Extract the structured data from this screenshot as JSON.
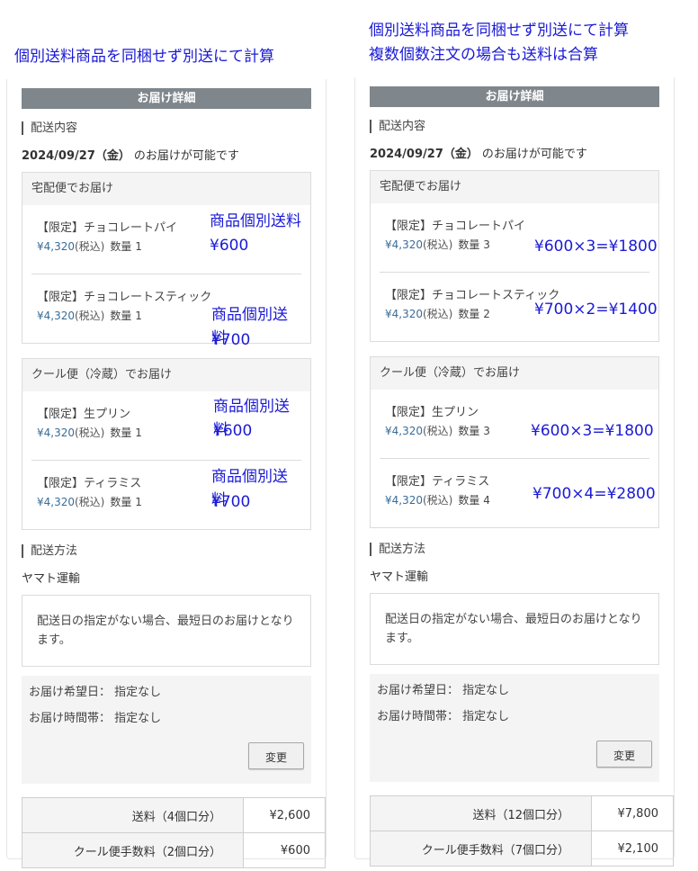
{
  "captions": {
    "left": "個別送料商品を同梱せず別送にて計算",
    "right_line1": "個別送料商品を同梱せず別送にて計算",
    "right_line2": "複数個数注文の場合も送料は合算"
  },
  "colors": {
    "header_bar": "#7f878d",
    "price_link": "#3a6d97",
    "annotation": "#1a1ad6"
  },
  "left": {
    "header": "お届け詳細",
    "section_contents": "配送内容",
    "delivery_date": "2024/09/27（金）",
    "delivery_date_suffix": "のお届けが可能です",
    "groups": [
      {
        "title": "宅配便でお届け",
        "items": [
          {
            "name": "【限定】チョコレートパイ",
            "price": "¥4,320",
            "tax": "(税込)",
            "qty": "数量 1",
            "anno1": "商品個別送料",
            "anno2": "¥600"
          },
          {
            "name": "【限定】チョコレートスティック",
            "price": "¥4,320",
            "tax": "(税込)",
            "qty": "数量 1",
            "anno1": "商品個別送料",
            "anno2": "¥700"
          }
        ]
      },
      {
        "title": "クール便（冷蔵）でお届け",
        "items": [
          {
            "name": "【限定】生プリン",
            "price": "¥4,320",
            "tax": "(税込)",
            "qty": "数量 1",
            "anno1": "商品個別送料",
            "anno2": "¥600"
          },
          {
            "name": "【限定】ティラミス",
            "price": "¥4,320",
            "tax": "(税込)",
            "qty": "数量 1",
            "anno1": "商品個別送料",
            "anno2": "¥700"
          }
        ]
      }
    ],
    "section_method": "配送方法",
    "carrier": "ヤマト運輸",
    "notice": "配送日の指定がない場合、最短日のお届けとなります。",
    "pref_date": "お届け希望日：  指定なし",
    "pref_time": "お届け時間帯：  指定なし",
    "change_label": "変更",
    "fees": [
      {
        "label": "送料（4個口分）",
        "value": "¥2,600"
      },
      {
        "label": "クール便手数料（2個口分）",
        "value": "¥600"
      }
    ]
  },
  "right": {
    "header": "お届け詳細",
    "section_contents": "配送内容",
    "delivery_date": "2024/09/27（金）",
    "delivery_date_suffix": "のお届けが可能です",
    "groups": [
      {
        "title": "宅配便でお届け",
        "items": [
          {
            "name": "【限定】チョコレートパイ",
            "price": "¥4,320",
            "tax": "(税込)",
            "qty": "数量 3",
            "anno": "¥600×3=¥1800"
          },
          {
            "name": "【限定】チョコレートスティック",
            "price": "¥4,320",
            "tax": "(税込)",
            "qty": "数量 2",
            "anno": "¥700×2=¥1400"
          }
        ]
      },
      {
        "title": "クール便（冷蔵）でお届け",
        "items": [
          {
            "name": "【限定】生プリン",
            "price": "¥4,320",
            "tax": "(税込)",
            "qty": "数量 3",
            "anno": "¥600×3=¥1800"
          },
          {
            "name": "【限定】ティラミス",
            "price": "¥4,320",
            "tax": "(税込)",
            "qty": "数量 4",
            "anno": "¥700×4=¥2800"
          }
        ]
      }
    ],
    "section_method": "配送方法",
    "carrier": "ヤマト運輸",
    "notice": "配送日の指定がない場合、最短日のお届けとなります。",
    "pref_date": "お届け希望日：  指定なし",
    "pref_time": "お届け時間帯：  指定なし",
    "change_label": "変更",
    "fees": [
      {
        "label": "送料（12個口分）",
        "value": "¥7,800"
      },
      {
        "label": "クール便手数料（7個口分）",
        "value": "¥2,100"
      }
    ]
  }
}
